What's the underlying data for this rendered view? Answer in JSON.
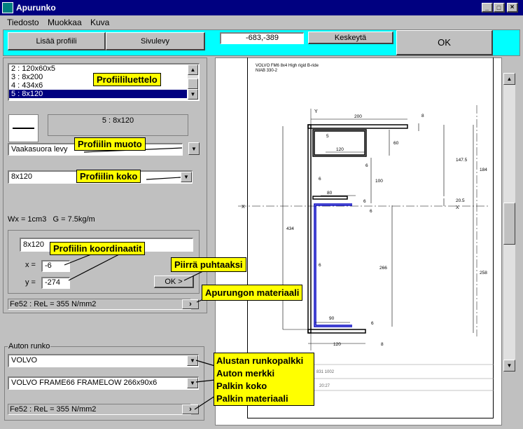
{
  "window": {
    "title": "Apurunko"
  },
  "menu": [
    "Tiedosto",
    "Muokkaa",
    "Kuva"
  ],
  "toolbar": {
    "add_profile": "Lisää profiili",
    "side_plate": "Sivulevy",
    "coords": "-683,-389",
    "cancel": "Keskeytä",
    "ok": "OK"
  },
  "profile_list": {
    "items": [
      "2 : 120x60x5",
      "3 : 8x200",
      "4 : 434x6",
      "5 : 8x120"
    ],
    "selected_index": 3
  },
  "profile_preview": {
    "label": "5 : 8x120"
  },
  "shape_select": {
    "value": "Vaakasuora levy"
  },
  "size_select": {
    "value": "8x120"
  },
  "section_props": "Wx = 1cm3   G = 7.5kg/m",
  "coordinates": {
    "name": "8x120",
    "x_label": "x =",
    "x_value": "-6",
    "y_label": "y =",
    "y_value": "-274",
    "ok_label": "OK >"
  },
  "material": {
    "value": "Fe52 : ReL = 355 N/mm2"
  },
  "vehicle_frame": {
    "group_label": "Auton runko",
    "make": "VOLVO",
    "beam": "VOLVO FRAME66 FRAMELOW 266x90x6",
    "material": "Fe52 : ReL = 355 N/mm2"
  },
  "callouts": {
    "profile_list": "Profiililuettelo",
    "profile_shape": "Profiilin muoto",
    "profile_size": "Profiilin koko",
    "profile_coords": "Profiilin koordinaatit",
    "draw_clean": "Piirrä puhtaaksi",
    "subframe_material": "Apurungon materiaali",
    "chassis_lines": [
      "Alustan runkopalkki",
      "Auton merkki",
      "Palkin koko",
      "Palkin materiaali"
    ]
  },
  "drawing": {
    "header_line1": "VOLVO FM6 8x4 High rigid B-ride",
    "header_line2": "NIAB 330-2",
    "dims": {
      "top_width": "200",
      "top_thk": "8",
      "box_width": "120",
      "box_height": "60",
      "box_thk": "5",
      "web_thk_a": "6",
      "inner_height": "100",
      "small_width": "80",
      "small_thk_a": "6",
      "small_thk_b": "6",
      "left_height": "434",
      "frame_height": "266",
      "bottom_inner_width": "90",
      "bottom_thk": "6",
      "bottom_width": "120",
      "bottom_plate_thk": "8",
      "upper_height": "147.5",
      "total_upper": "184",
      "gap": "20.5",
      "lower_height": "258",
      "axis_y": "Y",
      "axis_x_left": "X",
      "axis_x_right": "X",
      "web_thk_b": "6",
      "left_thk": "6"
    },
    "footer_code": "831 1002",
    "footer_time": "20:27"
  },
  "colors": {
    "accent_cyan": "#00ffff",
    "titlebar": "#000080",
    "callout": "#ffff00",
    "selection": "#000080",
    "frame_blue": "#0000c0"
  }
}
